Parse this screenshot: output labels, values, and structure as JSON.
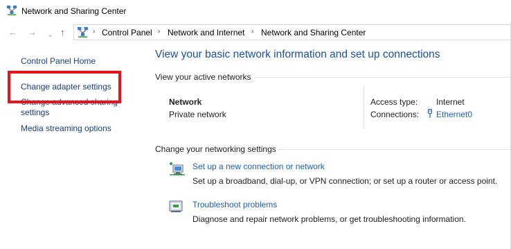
{
  "window": {
    "title": "Network and Sharing Center"
  },
  "nav": {
    "back_glyph": "←",
    "forward_glyph": "→",
    "recent_glyph": "⌄",
    "up_glyph": "↑"
  },
  "address": {
    "crumbs": [
      "Control Panel",
      "Network and Internet",
      "Network and Sharing Center"
    ],
    "separator": "›"
  },
  "sidebar": {
    "home": "Control Panel Home",
    "items": [
      {
        "label": "Change adapter settings"
      },
      {
        "label_line1": "Change advanced sharing",
        "label_line2": "settings"
      },
      {
        "label": "Media streaming options"
      }
    ],
    "highlight_color": "#e8141a"
  },
  "main": {
    "title": "View your basic network information and set up connections",
    "active_networks_heading": "View your active networks",
    "network": {
      "name": "Network",
      "type": "Private network",
      "access_type_label": "Access type:",
      "access_type_value": "Internet",
      "connections_label": "Connections:",
      "connection_name": "Ethernet0"
    },
    "change_heading": "Change your networking settings",
    "tasks": [
      {
        "icon": "new-connection-icon",
        "link": "Set up a new connection or network",
        "desc": "Set up a broadband, dial-up, or VPN connection; or set up a router or access point."
      },
      {
        "icon": "troubleshoot-icon",
        "link": "Troubleshoot problems",
        "desc": "Diagnose and repair network problems, or get troubleshooting information."
      }
    ]
  },
  "colors": {
    "link": "#1a5fb4",
    "sidebar_link": "#1a3d7c",
    "heading": "#1c4f9c"
  }
}
